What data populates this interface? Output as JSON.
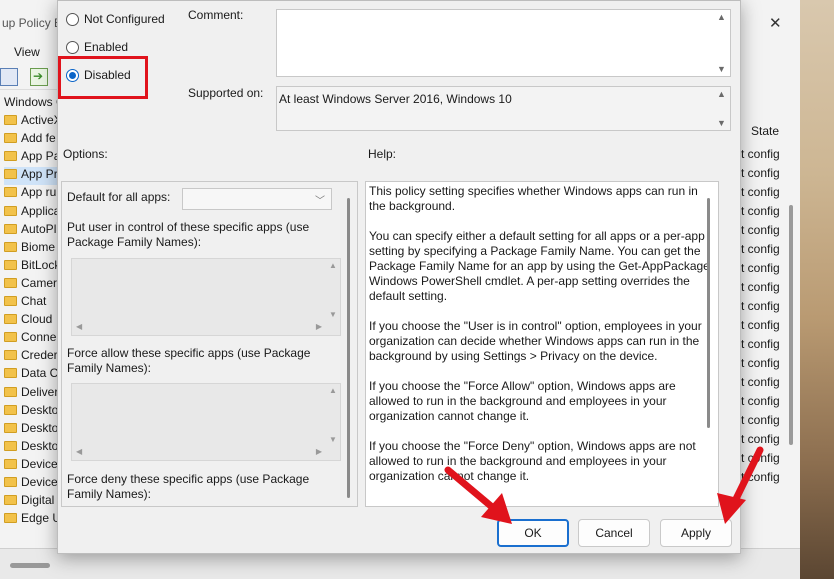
{
  "background_window": {
    "title": "up Policy E",
    "menu_view": "View",
    "tree_root": "Windows C",
    "tree_items": [
      "ActiveX",
      "Add fe",
      "App Pa",
      "App Pr",
      "App ru",
      "Applica",
      "AutoPl",
      "Biome",
      "BitLock",
      "Camer",
      "Chat",
      "Cloud",
      "Conne",
      "Creder",
      "Data C",
      "Deliver",
      "Deskto",
      "Deskto",
      "Deskto",
      "Device",
      "Device",
      "Digital",
      "Edge U"
    ],
    "state_header": "State",
    "state_cells": [
      "t config",
      "t config",
      "t config",
      "t config",
      "t config",
      "t config",
      "t config",
      "t config",
      "t config",
      "t config",
      "t config",
      "t config",
      "t config",
      "t config",
      "t config",
      "t config",
      "t config",
      "t config"
    ]
  },
  "dialog": {
    "radios": {
      "not_configured": "Not Configured",
      "enabled": "Enabled",
      "disabled": "Disabled"
    },
    "comment_label": "Comment:",
    "supported_label": "Supported on:",
    "supported_value": "At least Windows Server 2016, Windows 10",
    "options_label": "Options:",
    "help_label": "Help:",
    "options": {
      "default_label": "Default for all apps:",
      "default_value": "",
      "user_control_label": "Put user in control of these specific apps (use Package Family Names):",
      "force_allow_label": "Force allow these specific apps (use Package Family Names):",
      "force_deny_label": "Force deny these specific apps (use Package Family Names):"
    },
    "help_text": "This policy setting specifies whether Windows apps can run in the background.\n\nYou can specify either a default setting for all apps or a per-app setting by specifying a Package Family Name. You can get the Package Family Name for an app by using the Get-AppPackage Windows PowerShell cmdlet. A per-app setting overrides the default setting.\n\nIf you choose the \"User is in control\" option, employees in your organization can decide whether Windows apps can run in the background by using Settings > Privacy on the device.\n\nIf you choose the \"Force Allow\" option, Windows apps are allowed to run in the background and employees in your organization cannot change it.\n\nIf you choose the \"Force Deny\" option, Windows apps are not allowed to run in the background and employees in your organization cannot change it.",
    "buttons": {
      "ok": "OK",
      "cancel": "Cancel",
      "apply": "Apply"
    }
  },
  "annotations": {
    "color": "#e0131c"
  }
}
